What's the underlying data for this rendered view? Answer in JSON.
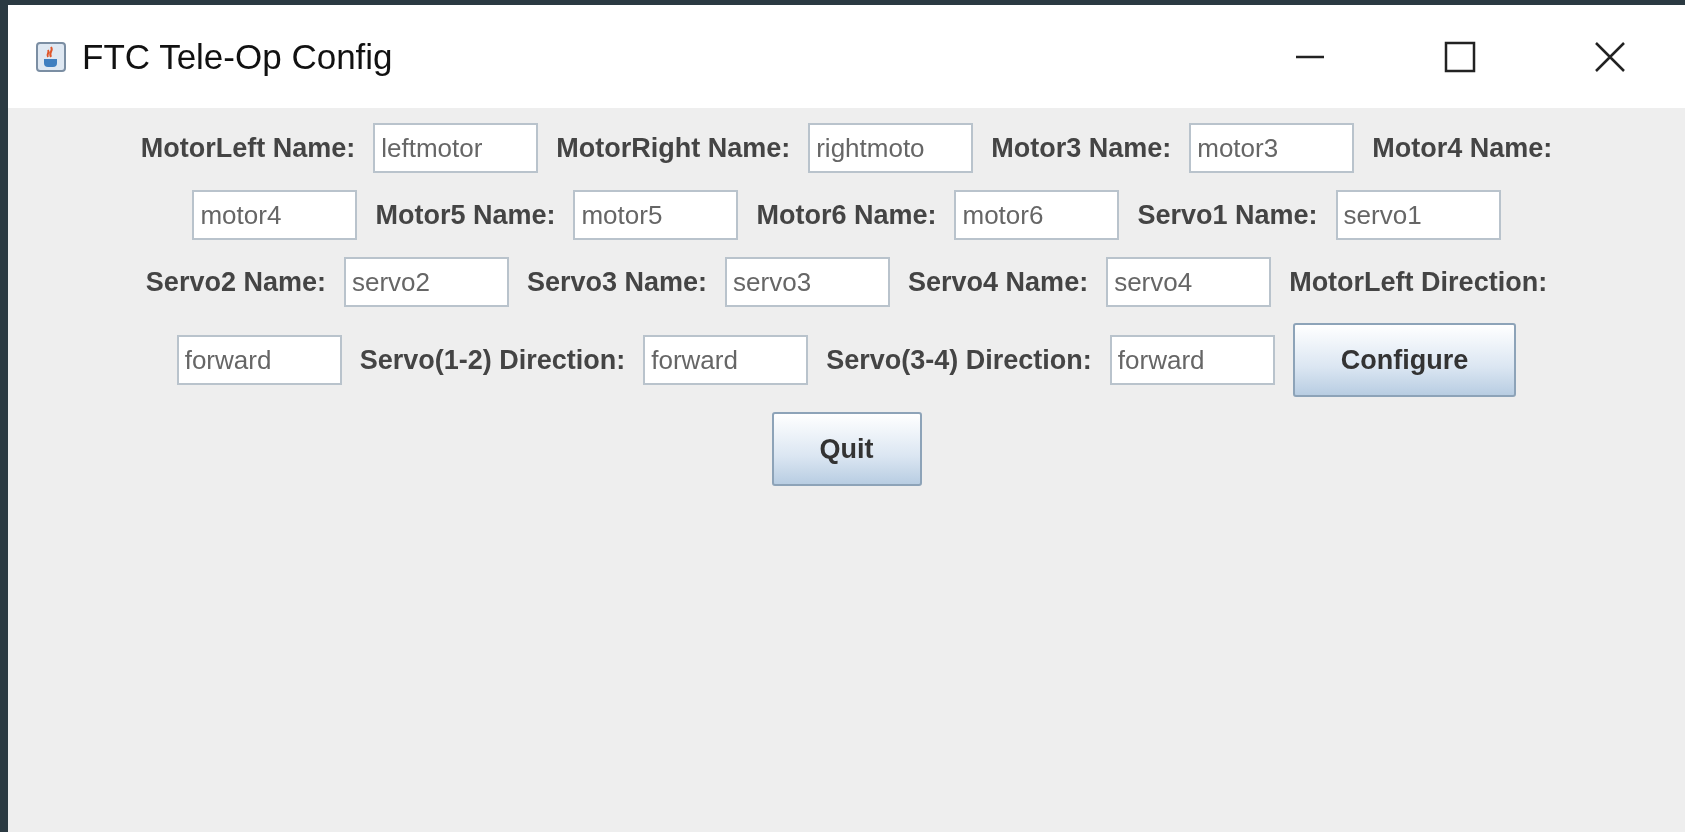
{
  "window": {
    "title": "FTC Tele-Op Config"
  },
  "rows": [
    [
      {
        "kind": "label",
        "text": "MotorLeft Name:"
      },
      {
        "kind": "field",
        "value": "leftmotor"
      },
      {
        "kind": "label",
        "text": "MotorRight Name:"
      },
      {
        "kind": "field",
        "value": "rightmoto"
      },
      {
        "kind": "label",
        "text": "Motor3 Name:"
      },
      {
        "kind": "field",
        "value": "motor3"
      },
      {
        "kind": "label",
        "text": "Motor4 Name:"
      }
    ],
    [
      {
        "kind": "field",
        "value": "motor4"
      },
      {
        "kind": "label",
        "text": "Motor5 Name:"
      },
      {
        "kind": "field",
        "value": "motor5"
      },
      {
        "kind": "label",
        "text": "Motor6 Name:"
      },
      {
        "kind": "field",
        "value": "motor6"
      },
      {
        "kind": "label",
        "text": "Servo1 Name:"
      },
      {
        "kind": "field",
        "value": "servo1"
      }
    ],
    [
      {
        "kind": "label",
        "text": "Servo2 Name:"
      },
      {
        "kind": "field",
        "value": "servo2"
      },
      {
        "kind": "label",
        "text": "Servo3 Name:"
      },
      {
        "kind": "field",
        "value": "servo3"
      },
      {
        "kind": "label",
        "text": "Servo4 Name:"
      },
      {
        "kind": "field",
        "value": "servo4"
      },
      {
        "kind": "label",
        "text": "MotorLeft Direction:"
      }
    ],
    [
      {
        "kind": "field",
        "value": "forward"
      },
      {
        "kind": "label",
        "text": "Servo(1-2) Direction:"
      },
      {
        "kind": "field",
        "value": "forward"
      },
      {
        "kind": "label",
        "text": "Servo(3-4) Direction:"
      },
      {
        "kind": "field",
        "value": "forward"
      },
      {
        "kind": "button",
        "text": "Configure"
      }
    ],
    [
      {
        "kind": "button",
        "text": "Quit"
      }
    ]
  ]
}
